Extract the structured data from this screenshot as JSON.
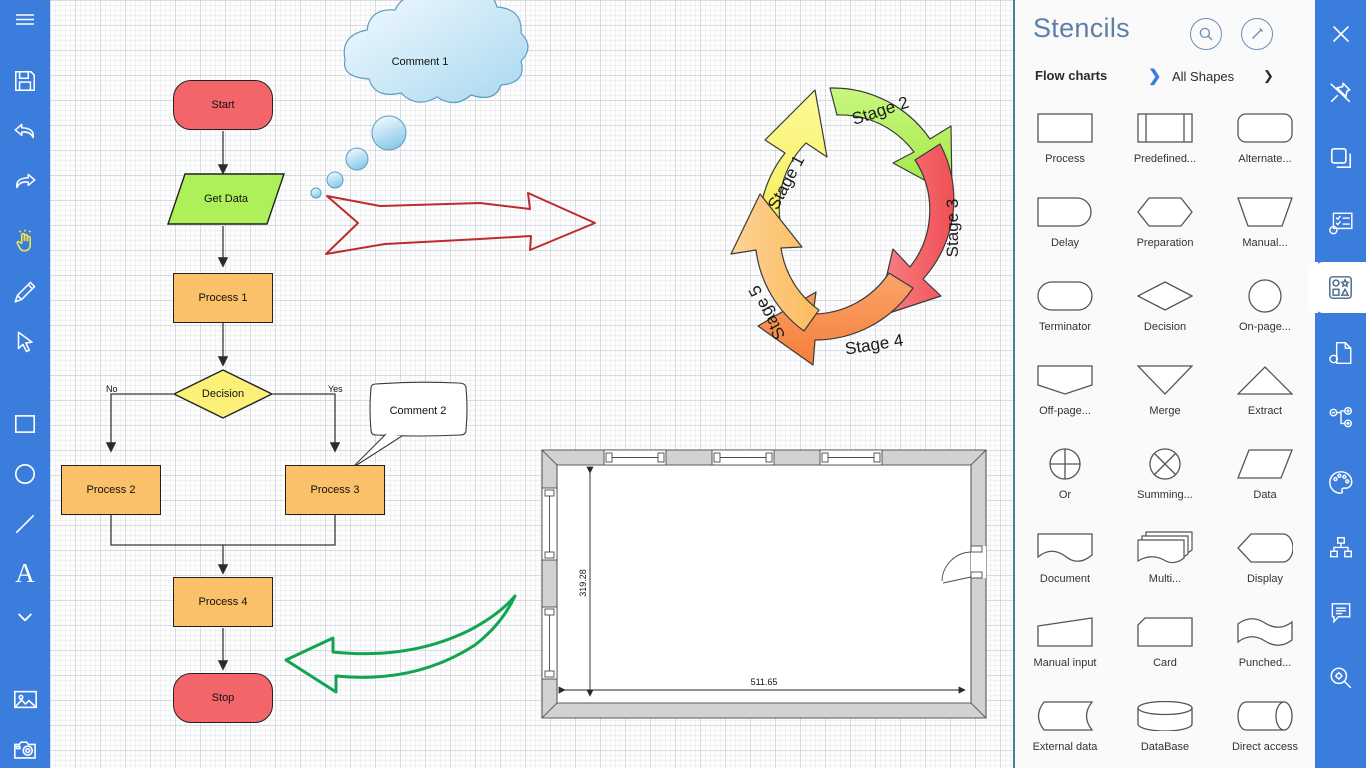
{
  "app": {
    "canvas_bg": "#fdfdfd",
    "accent": "#3b7ddd",
    "panel_bg": "#fafafa"
  },
  "left_toolbar": {
    "items": [
      {
        "name": "menu-icon",
        "label": "Menu"
      },
      {
        "name": "save-icon",
        "label": "Save"
      },
      {
        "name": "undo-icon",
        "label": "Undo"
      },
      {
        "name": "redo-icon",
        "label": "Redo"
      },
      {
        "name": "hand-pointer-icon",
        "label": "Select tool"
      },
      {
        "name": "pen-icon",
        "label": "Pen"
      },
      {
        "name": "cursor-arrow-icon",
        "label": "Pointer"
      },
      {
        "name": "rectangle-icon",
        "label": "Rectangle"
      },
      {
        "name": "ellipse-icon",
        "label": "Ellipse"
      },
      {
        "name": "line-icon",
        "label": "Line"
      },
      {
        "name": "text-icon",
        "label": "Text"
      },
      {
        "name": "chevron-down-icon",
        "label": "More"
      },
      {
        "name": "image-icon",
        "label": "Insert image"
      },
      {
        "name": "camera-icon",
        "label": "Camera"
      }
    ]
  },
  "canvas": {
    "flowchart": {
      "nodes": [
        {
          "id": "start",
          "label": "Start",
          "shape": "terminator",
          "color": "#f4656a"
        },
        {
          "id": "get-data",
          "label": "Get Data",
          "shape": "data",
          "color": "#aef059"
        },
        {
          "id": "process-1",
          "label": "Process 1",
          "shape": "process",
          "color": "#fbc168"
        },
        {
          "id": "decision",
          "label": "Decision",
          "shape": "decision",
          "color": "#fbf178"
        },
        {
          "id": "process-2",
          "label": "Process 2",
          "shape": "process",
          "color": "#fbc168"
        },
        {
          "id": "process-3",
          "label": "Process 3",
          "shape": "process",
          "color": "#fbc168"
        },
        {
          "id": "process-4",
          "label": "Process 4",
          "shape": "process",
          "color": "#fbc168"
        },
        {
          "id": "stop",
          "label": "Stop",
          "shape": "terminator",
          "color": "#f4656a"
        }
      ],
      "edge_labels": {
        "no": "No",
        "yes": "Yes"
      }
    },
    "comments": [
      {
        "id": "comment-1",
        "text": "Comment 1",
        "style": "thought-cloud"
      },
      {
        "id": "comment-2",
        "text": "Comment 2",
        "style": "callout-box"
      }
    ],
    "annotations": [
      {
        "id": "red-arrow",
        "color": "#c0272d",
        "shape": "sketch-arrow-right"
      },
      {
        "id": "green-arrow",
        "color": "#16a34a",
        "shape": "sketch-curved-arrow-left"
      }
    ],
    "cycle_diagram": {
      "title": "",
      "segments": [
        {
          "label": "Stage 1",
          "color": "#fbf36e"
        },
        {
          "label": "Stage 2",
          "color": "#aef059"
        },
        {
          "label": "Stage 3",
          "color": "#f4656a"
        },
        {
          "label": "Stage 4",
          "color": "#f78b4e"
        },
        {
          "label": "Stage 5",
          "color": "#fbc168"
        }
      ]
    },
    "floorplan": {
      "dim_vertical": "319.28",
      "dim_horizontal": "511.65",
      "wall_fill": "#d4d4d4",
      "windows": 5,
      "doors": 1
    }
  },
  "stencils": {
    "title": "Stencils",
    "search_icon": "search-icon",
    "edit_icon": "pencil-circle-icon",
    "category": "Flow charts",
    "separator_icon": "chevron-right-icon",
    "filter": "All Shapes",
    "filter_icon": "chevron-down-icon",
    "shapes": [
      {
        "label": "Process",
        "icon": "rect-shape"
      },
      {
        "label": "Predefined...",
        "icon": "predefined-process-shape"
      },
      {
        "label": "Alternate...",
        "icon": "rounded-rect-shape"
      },
      {
        "label": "Delay",
        "icon": "delay-shape"
      },
      {
        "label": "Preparation",
        "icon": "hexagon-shape"
      },
      {
        "label": "Manual...",
        "icon": "trapezoid-down-shape"
      },
      {
        "label": "Terminator",
        "icon": "stadium-shape"
      },
      {
        "label": "Decision",
        "icon": "diamond-shape"
      },
      {
        "label": "On-page...",
        "icon": "circle-shape"
      },
      {
        "label": "Off-page...",
        "icon": "offpage-shape"
      },
      {
        "label": "Merge",
        "icon": "triangle-down-shape"
      },
      {
        "label": "Extract",
        "icon": "triangle-up-shape"
      },
      {
        "label": "Or",
        "icon": "circle-plus-shape"
      },
      {
        "label": "Summing...",
        "icon": "circle-cross-shape"
      },
      {
        "label": "Data",
        "icon": "parallelogram-shape"
      },
      {
        "label": "Document",
        "icon": "document-shape"
      },
      {
        "label": "Multi...",
        "icon": "multi-document-shape"
      },
      {
        "label": "Display",
        "icon": "display-shape"
      },
      {
        "label": "Manual input",
        "icon": "manual-input-shape"
      },
      {
        "label": "Card",
        "icon": "card-shape"
      },
      {
        "label": "Punched...",
        "icon": "punched-tape-shape"
      },
      {
        "label": "External data",
        "icon": "external-data-shape"
      },
      {
        "label": "DataBase",
        "icon": "database-shape"
      },
      {
        "label": "Direct access",
        "icon": "direct-access-shape"
      }
    ]
  },
  "right_rail": {
    "items": [
      {
        "name": "close-icon",
        "label": "Close",
        "selected": false
      },
      {
        "name": "unpin-icon",
        "label": "Unpin panel",
        "selected": false
      },
      {
        "name": "layers-icon",
        "label": "Layers",
        "selected": false
      },
      {
        "name": "properties-icon",
        "label": "Properties",
        "selected": false
      },
      {
        "name": "shapes-icon",
        "label": "Stencils",
        "selected": true
      },
      {
        "name": "document-settings-icon",
        "label": "Document",
        "selected": false
      },
      {
        "name": "hierarchy-icon",
        "label": "Structure",
        "selected": false
      },
      {
        "name": "palette-icon",
        "label": "Theme",
        "selected": false
      },
      {
        "name": "org-chart-icon",
        "label": "Org chart",
        "selected": false
      },
      {
        "name": "comment-icon",
        "label": "Comments",
        "selected": false
      },
      {
        "name": "zoom-icon",
        "label": "Zoom",
        "selected": false
      }
    ]
  }
}
